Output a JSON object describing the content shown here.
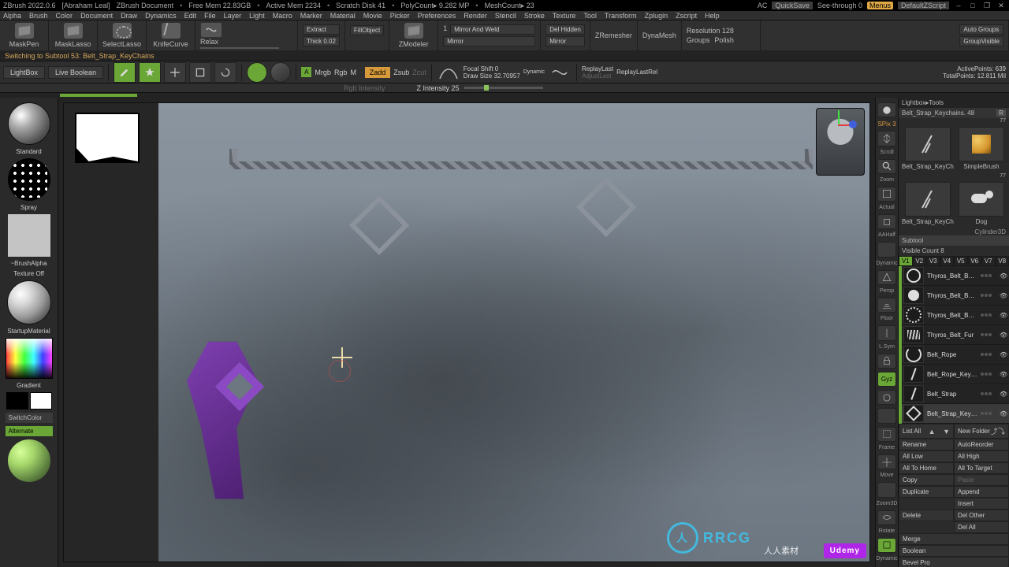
{
  "title": {
    "app": "ZBrush 2022.0.6",
    "user": "[Abraham Leal]",
    "doc": "ZBrush Document",
    "free_mem": "Free Mem 22.83GB",
    "active_mem": "Active Mem 2234",
    "scratch_disk": "Scratch Disk 41",
    "polycount": "PolyCount▸ 9.282 MP",
    "meshcount": "MeshCount▸ 23",
    "ac": "AC",
    "quicksave": "QuickSave",
    "seethrough": "See-through  0",
    "menus": "Menus",
    "defaultscript": "DefaultZScript"
  },
  "menus": [
    "Alpha",
    "Brush",
    "Color",
    "Document",
    "Draw",
    "Dynamics",
    "Edit",
    "File",
    "Layer",
    "Light",
    "Macro",
    "Marker",
    "Material",
    "Movie",
    "Picker",
    "Preferences",
    "Render",
    "Stencil",
    "Stroke",
    "Texture",
    "Tool",
    "Transform",
    "Zplugin",
    "Zscript",
    "Help"
  ],
  "toolbar1": {
    "masken_label": "MaskPen",
    "masklasso_label": "MaskLasso",
    "selectlasso_label": "SelectLasso",
    "knifecurve_label": "KnifeCurve",
    "relax_label": "Relax",
    "extract_label": "Extract",
    "thick_label": "Thick 0.02",
    "fillobject": "FillObject",
    "zmodeler": "ZModeler",
    "mirror_weld": "Mirror And Weld",
    "mirror": "Mirror",
    "mirror_group_count": "1",
    "del_hidden": "Del Hidden",
    "mirror2": "Mirror",
    "zremesher": "ZRemesher",
    "dynamesh": "DynaMesh",
    "resolution": "Resolution 128",
    "groups": "Groups",
    "polish": "Polish",
    "autogroups": "Auto Groups",
    "groupvisible": "GroupVisible"
  },
  "status": {
    "msg_prefix": "Switching to Subtool 53:",
    "msg_name": "Belt_Strap_KeyChains"
  },
  "toolbar2": {
    "lightbox": "LightBox",
    "livebool": "Live Boolean",
    "gizmo_labels": [
      "Edit",
      "Draw",
      "Move",
      "Scale",
      "Rotate"
    ],
    "a": "A",
    "mrgb": "Mrgb",
    "rgb": "Rgb",
    "rgb_intensity": "Rgb Intensity",
    "m": "M",
    "zadd": "Zadd",
    "zsub": "Zsub",
    "zcut": "Zcut",
    "zintensity": "Z Intensity 25",
    "focal_shift": "Focal Shift 0",
    "draw_size": "Draw Size 32.70957",
    "dynamic": "Dynamic",
    "replaylast": "ReplayLast",
    "replaylastrel": "ReplayLastRel",
    "activepoints": "ActivePoints: 639",
    "totalpoints": "TotalPoints: 12.811 Mil",
    "adjustlast": "AdjustLast"
  },
  "leftcol": {
    "standard": "Standard",
    "spray": "Spray",
    "brushalpha": "~BrushAlpha",
    "texture_off": "Texture Off",
    "startup_material": "StartupMaterial",
    "gradient": "Gradient",
    "switchcolor": "SwitchColor",
    "alternate": "Alternate"
  },
  "iconcol": {
    "spix": "SPix 3",
    "labels": [
      "Scroll",
      "Zoom",
      "Actual",
      "AAHalf",
      "Dynamic",
      "Persp",
      "Floor",
      "L.Sym",
      "Lock",
      "Gyz",
      "Frame",
      "Move",
      "Zoom3D",
      "Rotate",
      "Dynamic"
    ]
  },
  "rightpanel": {
    "crumb": "Lightbox▸Tools",
    "tool_label": "Belt_Strap_Keychains. 48",
    "r": "R",
    "count_small": "77",
    "thumb1_name": "Belt_Strap_KeyCh",
    "thumb2_name": "SimpleBrush",
    "count_small2": "77",
    "thumb3_name": "Belt_Strap_KeyCh",
    "thumb4_name": "Dog",
    "subtool_hdr": "Subtool",
    "visible_count": "Visible Count 8",
    "vtabs": [
      "V1",
      "V2",
      "V3",
      "V4",
      "V5",
      "V6",
      "V7",
      "V8"
    ],
    "subtools": [
      {
        "name": "Thyros_Belt_Buckle_Border",
        "icon": "circ"
      },
      {
        "name": "Thyros_Belt_Buckle_Base",
        "icon": "circfill"
      },
      {
        "name": "Thyros_Belt_Buckle_Spikes",
        "icon": "ringdot"
      },
      {
        "name": "Thyros_Belt_Fur",
        "icon": "fur"
      },
      {
        "name": "Belt_Rope",
        "icon": "rope"
      },
      {
        "name": "Belt_Rope_Keychains",
        "icon": "line"
      },
      {
        "name": "Belt_Strap",
        "icon": "line"
      },
      {
        "name": "Belt_Strap_KeyChains",
        "icon": "key",
        "selected": true
      }
    ],
    "cylinder3d": "Cylinder3D",
    "actions": {
      "list_all": "List All",
      "new_folder": "New Folder",
      "rename": "Rename",
      "autoreorder": "AutoReorder",
      "all_low": "All Low",
      "all_high": "All High",
      "all_to_home": "All To Home",
      "all_to_target": "All To Target",
      "copy": "Copy",
      "paste": "Paste",
      "duplicate": "Duplicate",
      "append": "Append",
      "insert": "Insert",
      "delete": "Delete",
      "del_other": "Del Other",
      "del_all": "Del All",
      "merge": "Merge",
      "boolean": "Boolean",
      "bevel_pro": "Bevel Pro"
    }
  },
  "watermark": {
    "site": "RRCG",
    "cn": "人人素材",
    "udemy": "Udemy"
  }
}
